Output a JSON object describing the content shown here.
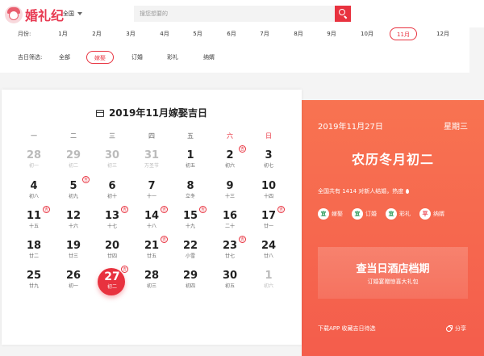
{
  "header": {
    "logo_text": "婚礼纪",
    "city": "全国",
    "search_placeholder": "搜您想要的"
  },
  "filters": {
    "month_label": "月份:",
    "months": [
      "1月",
      "2月",
      "3月",
      "4月",
      "5月",
      "6月",
      "7月",
      "8月",
      "9月",
      "10月",
      "11月",
      "12月"
    ],
    "selected_month": "11月",
    "type_label": "吉日筛选:",
    "types": [
      "全部",
      "嫁娶",
      "订婚",
      "彩礼",
      "纳婿"
    ],
    "selected_type": "嫁娶"
  },
  "calendar": {
    "title": "2019年11月嫁娶吉日",
    "weekdays": [
      "一",
      "二",
      "三",
      "四",
      "五",
      "六",
      "日"
    ],
    "days": [
      {
        "num": "28",
        "sub": "初一",
        "grey": true,
        "ji": false
      },
      {
        "num": "29",
        "sub": "初二",
        "grey": true,
        "ji": false
      },
      {
        "num": "30",
        "sub": "初三",
        "grey": true,
        "ji": false
      },
      {
        "num": "31",
        "sub": "万圣节",
        "grey": true,
        "ji": false
      },
      {
        "num": "1",
        "sub": "初五",
        "grey": false,
        "ji": false
      },
      {
        "num": "2",
        "sub": "初六",
        "grey": false,
        "ji": true
      },
      {
        "num": "3",
        "sub": "初七",
        "grey": false,
        "ji": false
      },
      {
        "num": "4",
        "sub": "初八",
        "grey": false,
        "ji": false
      },
      {
        "num": "5",
        "sub": "初九",
        "grey": false,
        "ji": true
      },
      {
        "num": "6",
        "sub": "初十",
        "grey": false,
        "ji": false
      },
      {
        "num": "7",
        "sub": "十一",
        "grey": false,
        "ji": false
      },
      {
        "num": "8",
        "sub": "立冬",
        "grey": false,
        "ji": false
      },
      {
        "num": "9",
        "sub": "十三",
        "grey": false,
        "ji": false
      },
      {
        "num": "10",
        "sub": "十四",
        "grey": false,
        "ji": false
      },
      {
        "num": "11",
        "sub": "十五",
        "grey": false,
        "ji": true
      },
      {
        "num": "12",
        "sub": "十六",
        "grey": false,
        "ji": false
      },
      {
        "num": "13",
        "sub": "十七",
        "grey": false,
        "ji": true
      },
      {
        "num": "14",
        "sub": "十八",
        "grey": false,
        "ji": true
      },
      {
        "num": "15",
        "sub": "十九",
        "grey": false,
        "ji": true
      },
      {
        "num": "16",
        "sub": "二十",
        "grey": false,
        "ji": false
      },
      {
        "num": "17",
        "sub": "廿一",
        "grey": false,
        "ji": true
      },
      {
        "num": "18",
        "sub": "廿二",
        "grey": false,
        "ji": false
      },
      {
        "num": "19",
        "sub": "廿三",
        "grey": false,
        "ji": false
      },
      {
        "num": "20",
        "sub": "廿四",
        "grey": false,
        "ji": false
      },
      {
        "num": "21",
        "sub": "廿五",
        "grey": false,
        "ji": true
      },
      {
        "num": "22",
        "sub": "小雪",
        "grey": false,
        "ji": false
      },
      {
        "num": "23",
        "sub": "廿七",
        "grey": false,
        "ji": true
      },
      {
        "num": "24",
        "sub": "廿八",
        "grey": false,
        "ji": false
      },
      {
        "num": "25",
        "sub": "廿九",
        "grey": false,
        "ji": false
      },
      {
        "num": "26",
        "sub": "初一",
        "grey": false,
        "ji": false
      },
      {
        "num": "27",
        "sub": "初二",
        "grey": false,
        "ji": true,
        "today": true
      },
      {
        "num": "28",
        "sub": "初三",
        "grey": false,
        "ji": false
      },
      {
        "num": "29",
        "sub": "初四",
        "grey": false,
        "ji": false
      },
      {
        "num": "30",
        "sub": "初五",
        "grey": false,
        "ji": false
      },
      {
        "num": "1",
        "sub": "初六",
        "grey": true,
        "ji": false
      }
    ],
    "ji_mark": "吉"
  },
  "info": {
    "date": "2019年11月27日",
    "weekday": "星期三",
    "lunar": "农历冬月初二",
    "stats": "全国共有 1414 对新人结婚，热度",
    "tags": [
      {
        "badge": "宜",
        "label": "嫁娶",
        "good": true
      },
      {
        "badge": "宜",
        "label": "订婚",
        "good": true
      },
      {
        "badge": "宜",
        "label": "彩礼",
        "good": true
      },
      {
        "badge": "平",
        "label": "纳婿",
        "good": false
      }
    ],
    "promo_title": "查当日酒店档期",
    "promo_sub": "订婚宴赠惊喜大礼包",
    "download": "下载APP 收藏吉日待选",
    "share": "分享"
  },
  "colors": {
    "brand_red": "#e8323f",
    "info_orange": "#f45d4c",
    "good_green": "#2c9a59"
  }
}
